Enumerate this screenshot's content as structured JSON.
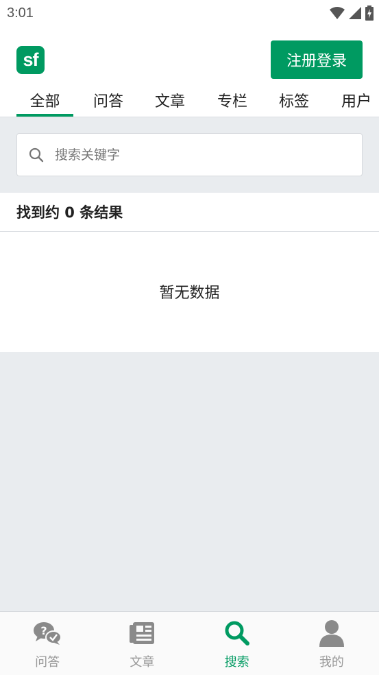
{
  "status_bar": {
    "time": "3:01"
  },
  "header": {
    "logo_text": "sf",
    "login_button": "注册登录"
  },
  "tabs": [
    {
      "label": "全部",
      "active": true
    },
    {
      "label": "问答"
    },
    {
      "label": "文章"
    },
    {
      "label": "专栏"
    },
    {
      "label": "标签"
    },
    {
      "label": "用户"
    }
  ],
  "search": {
    "placeholder": "搜索关键字",
    "value": ""
  },
  "results": {
    "count_text": "找到约 0 条结果",
    "empty_text": "暂无数据"
  },
  "bottom_nav": [
    {
      "label": "问答",
      "icon": "qa-icon"
    },
    {
      "label": "文章",
      "icon": "article-icon"
    },
    {
      "label": "搜索",
      "icon": "search-icon",
      "active": true
    },
    {
      "label": "我的",
      "icon": "user-icon"
    }
  ],
  "colors": {
    "accent": "#009a61",
    "background": "#e9ecef",
    "inactive": "#999999"
  }
}
